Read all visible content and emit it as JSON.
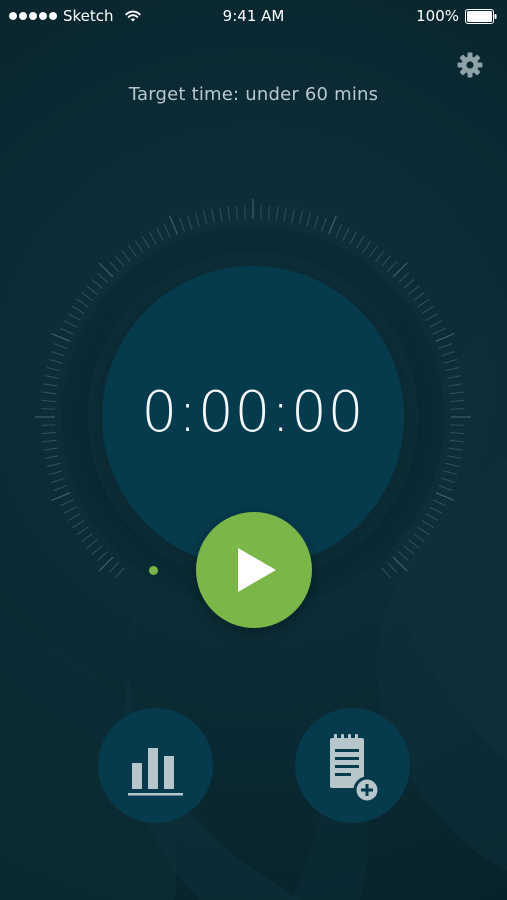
{
  "status_bar": {
    "carrier": "Sketch",
    "time": "9:41 AM",
    "battery": "100%",
    "signal_icon": "signal-dots-icon",
    "wifi_icon": "wifi-icon",
    "battery_icon": "battery-icon"
  },
  "header": {
    "settings_icon": "gear-icon",
    "target_text": "Target time: under 60 mins"
  },
  "timer": {
    "value": "0:00:00",
    "play_icon": "play-icon"
  },
  "bottom_actions": {
    "stats_icon": "bar-chart-icon",
    "log_icon": "clipboard-add-icon"
  },
  "colors": {
    "background": "#0b2a33",
    "circle": "#063a4d",
    "accent": "#7ab648",
    "icon": "#b7c6ca"
  }
}
